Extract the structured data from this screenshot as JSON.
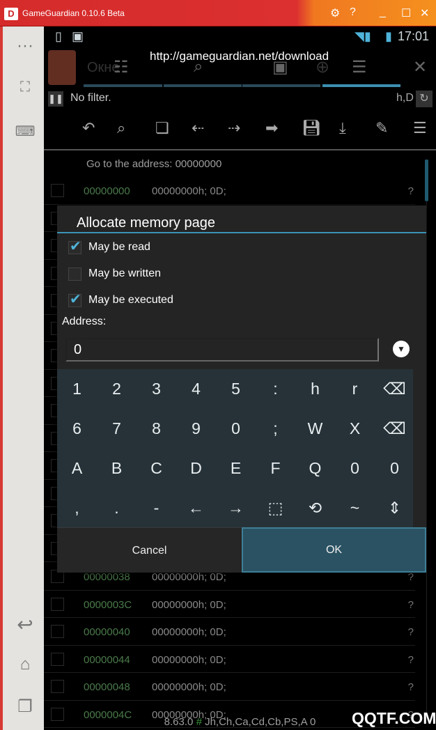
{
  "window": {
    "title": "GameGuardian 0.10.6 Beta",
    "accent": "#d52b2b",
    "accent2": "#f5901e"
  },
  "status_bar": {
    "time": "17:01"
  },
  "overlay_url": "http://gameguardian.net/download",
  "action_bar": {
    "tab_partial": "Окне"
  },
  "filter": {
    "text": "No filter.",
    "format": "h,D"
  },
  "goto": "Go to the address: 00000000",
  "rows": [
    {
      "addr": "00000000",
      "value": "00000000h;  0D;",
      "flag": "?"
    },
    {
      "addr": "00000038",
      "value": "00000000h;  0D;",
      "flag": "?"
    },
    {
      "addr": "0000003C",
      "value": "00000000h;  0D;",
      "flag": "?"
    },
    {
      "addr": "00000040",
      "value": "00000000h;  0D;",
      "flag": "?"
    },
    {
      "addr": "00000044",
      "value": "00000000h;  0D;",
      "flag": "?"
    },
    {
      "addr": "00000048",
      "value": "00000000h;  0D;",
      "flag": "?"
    },
    {
      "addr": "0000004C",
      "value": "00000000h;  0D;",
      "flag": "?"
    }
  ],
  "dialog": {
    "title": "Allocate memory page",
    "options": [
      {
        "label": "May be read",
        "checked": true
      },
      {
        "label": "May be written",
        "checked": false
      },
      {
        "label": "May be executed",
        "checked": true
      }
    ],
    "address_label": "Address:",
    "address_value": "0",
    "cancel": "Cancel",
    "ok": "OK"
  },
  "keyboard": [
    [
      "1",
      "2",
      "3",
      "4",
      "5",
      ":",
      "h",
      "r",
      "⌫"
    ],
    [
      "6",
      "7",
      "8",
      "9",
      "0",
      ";",
      "W",
      "X",
      "⌫"
    ],
    [
      "A",
      "B",
      "C",
      "D",
      "E",
      "F",
      "Q",
      "0",
      "0"
    ],
    [
      ",",
      ".",
      "-",
      "←",
      "→",
      "⬚",
      "⟲",
      "~",
      "⇕"
    ]
  ],
  "footer": {
    "version": "8.63.0",
    "hash": "#",
    "regions": "Jh,Ch,Ca,Cd,Cb,PS,A 0"
  },
  "watermark": "QQTF.COM"
}
